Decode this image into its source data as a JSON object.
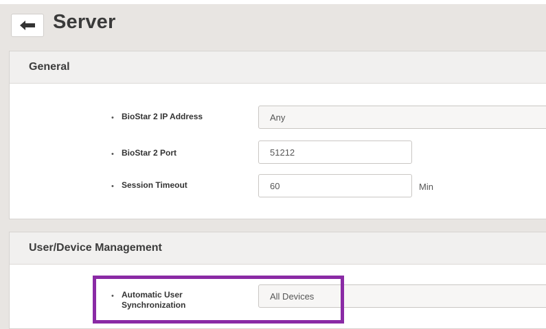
{
  "header": {
    "title": "Server",
    "back_icon": "arrow-left-icon"
  },
  "sections": {
    "general": {
      "title": "General",
      "ip_address": {
        "label": "BioStar 2 IP Address",
        "value": "Any"
      },
      "port": {
        "label": "BioStar 2 Port",
        "value": "51212"
      },
      "session_timeout": {
        "label": "Session Timeout",
        "value": "60",
        "unit": "Min"
      }
    },
    "user_device": {
      "title": "User/Device Management",
      "auto_sync": {
        "label_line1": "Automatic User",
        "label_line2": "Synchronization",
        "value": "All Devices"
      }
    }
  },
  "colors": {
    "highlight": "#8a2aa5",
    "background": "#e8e5e2"
  }
}
